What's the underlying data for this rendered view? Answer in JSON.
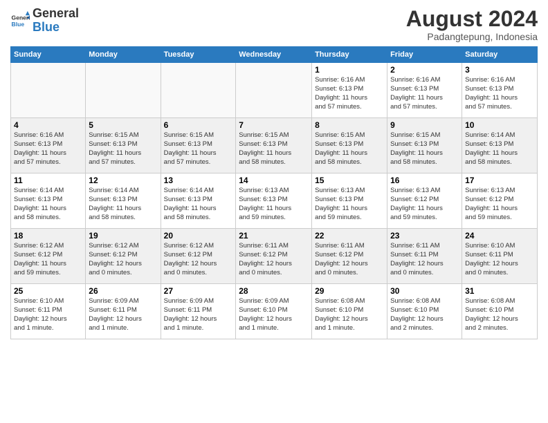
{
  "header": {
    "logo_line1": "General",
    "logo_line2": "Blue",
    "title": "August 2024",
    "subtitle": "Padangtepung, Indonesia"
  },
  "weekdays": [
    "Sunday",
    "Monday",
    "Tuesday",
    "Wednesday",
    "Thursday",
    "Friday",
    "Saturday"
  ],
  "weeks": [
    [
      {
        "day": "",
        "info": ""
      },
      {
        "day": "",
        "info": ""
      },
      {
        "day": "",
        "info": ""
      },
      {
        "day": "",
        "info": ""
      },
      {
        "day": "1",
        "info": "Sunrise: 6:16 AM\nSunset: 6:13 PM\nDaylight: 11 hours\nand 57 minutes."
      },
      {
        "day": "2",
        "info": "Sunrise: 6:16 AM\nSunset: 6:13 PM\nDaylight: 11 hours\nand 57 minutes."
      },
      {
        "day": "3",
        "info": "Sunrise: 6:16 AM\nSunset: 6:13 PM\nDaylight: 11 hours\nand 57 minutes."
      }
    ],
    [
      {
        "day": "4",
        "info": "Sunrise: 6:16 AM\nSunset: 6:13 PM\nDaylight: 11 hours\nand 57 minutes."
      },
      {
        "day": "5",
        "info": "Sunrise: 6:15 AM\nSunset: 6:13 PM\nDaylight: 11 hours\nand 57 minutes."
      },
      {
        "day": "6",
        "info": "Sunrise: 6:15 AM\nSunset: 6:13 PM\nDaylight: 11 hours\nand 57 minutes."
      },
      {
        "day": "7",
        "info": "Sunrise: 6:15 AM\nSunset: 6:13 PM\nDaylight: 11 hours\nand 58 minutes."
      },
      {
        "day": "8",
        "info": "Sunrise: 6:15 AM\nSunset: 6:13 PM\nDaylight: 11 hours\nand 58 minutes."
      },
      {
        "day": "9",
        "info": "Sunrise: 6:15 AM\nSunset: 6:13 PM\nDaylight: 11 hours\nand 58 minutes."
      },
      {
        "day": "10",
        "info": "Sunrise: 6:14 AM\nSunset: 6:13 PM\nDaylight: 11 hours\nand 58 minutes."
      }
    ],
    [
      {
        "day": "11",
        "info": "Sunrise: 6:14 AM\nSunset: 6:13 PM\nDaylight: 11 hours\nand 58 minutes."
      },
      {
        "day": "12",
        "info": "Sunrise: 6:14 AM\nSunset: 6:13 PM\nDaylight: 11 hours\nand 58 minutes."
      },
      {
        "day": "13",
        "info": "Sunrise: 6:14 AM\nSunset: 6:13 PM\nDaylight: 11 hours\nand 58 minutes."
      },
      {
        "day": "14",
        "info": "Sunrise: 6:13 AM\nSunset: 6:13 PM\nDaylight: 11 hours\nand 59 minutes."
      },
      {
        "day": "15",
        "info": "Sunrise: 6:13 AM\nSunset: 6:13 PM\nDaylight: 11 hours\nand 59 minutes."
      },
      {
        "day": "16",
        "info": "Sunrise: 6:13 AM\nSunset: 6:12 PM\nDaylight: 11 hours\nand 59 minutes."
      },
      {
        "day": "17",
        "info": "Sunrise: 6:13 AM\nSunset: 6:12 PM\nDaylight: 11 hours\nand 59 minutes."
      }
    ],
    [
      {
        "day": "18",
        "info": "Sunrise: 6:12 AM\nSunset: 6:12 PM\nDaylight: 11 hours\nand 59 minutes."
      },
      {
        "day": "19",
        "info": "Sunrise: 6:12 AM\nSunset: 6:12 PM\nDaylight: 12 hours\nand 0 minutes."
      },
      {
        "day": "20",
        "info": "Sunrise: 6:12 AM\nSunset: 6:12 PM\nDaylight: 12 hours\nand 0 minutes."
      },
      {
        "day": "21",
        "info": "Sunrise: 6:11 AM\nSunset: 6:12 PM\nDaylight: 12 hours\nand 0 minutes."
      },
      {
        "day": "22",
        "info": "Sunrise: 6:11 AM\nSunset: 6:12 PM\nDaylight: 12 hours\nand 0 minutes."
      },
      {
        "day": "23",
        "info": "Sunrise: 6:11 AM\nSunset: 6:11 PM\nDaylight: 12 hours\nand 0 minutes."
      },
      {
        "day": "24",
        "info": "Sunrise: 6:10 AM\nSunset: 6:11 PM\nDaylight: 12 hours\nand 0 minutes."
      }
    ],
    [
      {
        "day": "25",
        "info": "Sunrise: 6:10 AM\nSunset: 6:11 PM\nDaylight: 12 hours\nand 1 minute."
      },
      {
        "day": "26",
        "info": "Sunrise: 6:09 AM\nSunset: 6:11 PM\nDaylight: 12 hours\nand 1 minute."
      },
      {
        "day": "27",
        "info": "Sunrise: 6:09 AM\nSunset: 6:11 PM\nDaylight: 12 hours\nand 1 minute."
      },
      {
        "day": "28",
        "info": "Sunrise: 6:09 AM\nSunset: 6:10 PM\nDaylight: 12 hours\nand 1 minute."
      },
      {
        "day": "29",
        "info": "Sunrise: 6:08 AM\nSunset: 6:10 PM\nDaylight: 12 hours\nand 1 minute."
      },
      {
        "day": "30",
        "info": "Sunrise: 6:08 AM\nSunset: 6:10 PM\nDaylight: 12 hours\nand 2 minutes."
      },
      {
        "day": "31",
        "info": "Sunrise: 6:08 AM\nSunset: 6:10 PM\nDaylight: 12 hours\nand 2 minutes."
      }
    ]
  ]
}
